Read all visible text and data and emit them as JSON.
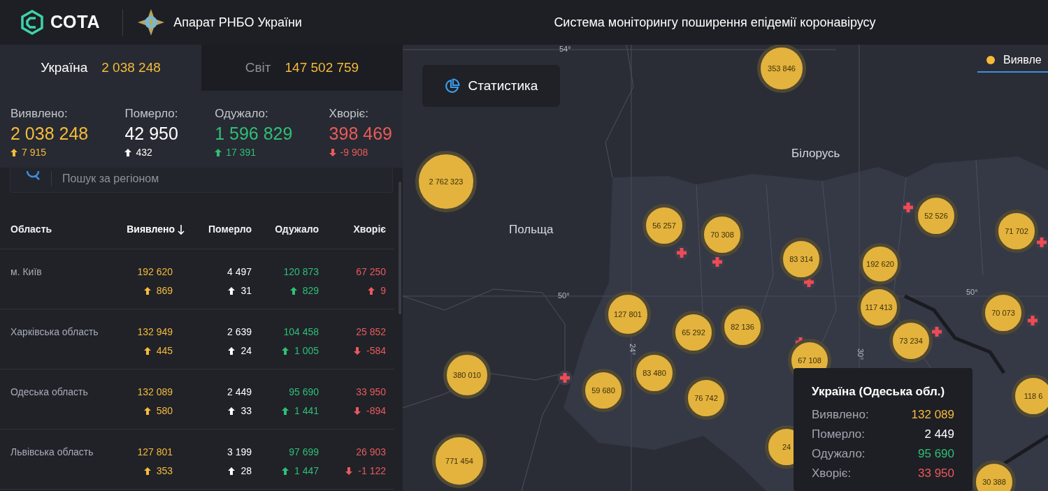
{
  "header": {
    "logo": "СОТА",
    "organization": "Апарат РНБО України",
    "title": "Система моніторингу поширення епідемії коронавірусу"
  },
  "scope_tabs": [
    {
      "label": "Україна",
      "total": "2 038 248",
      "selected": true
    },
    {
      "label": "Світ",
      "total": "147 502 759",
      "selected": false
    }
  ],
  "summary": [
    {
      "label": "Виявлено:",
      "value": "2 038 248",
      "change": "7 915",
      "rising": true,
      "color": "#f6bb3a"
    },
    {
      "label": "Померло:",
      "value": "42 950",
      "change": "432",
      "rising": true,
      "color": "#ffffff"
    },
    {
      "label": "Одужало:",
      "value": "1 596 829",
      "change": "17 391",
      "rising": true,
      "color": "#2fbf76"
    },
    {
      "label": "Хворіє:",
      "value": "398 469",
      "change": "-9 908",
      "rising": false,
      "color": "#ea5a5a"
    }
  ],
  "search": {
    "placeholder": "Пошук за регіоном"
  },
  "table": {
    "columns": [
      {
        "label": "Область",
        "sorted": false
      },
      {
        "label": "Виявлено",
        "sorted": true,
        "color": "#f6bb3a"
      },
      {
        "label": "Померло",
        "sorted": false,
        "color": "#ffffff"
      },
      {
        "label": "Одужало",
        "sorted": false,
        "color": "#2fbf76"
      },
      {
        "label": "Хворіє",
        "sorted": false,
        "color": "#ea5a5a"
      }
    ],
    "rows": [
      {
        "cells": [
          {
            "value": "м. Київ"
          },
          {
            "value": "192 620",
            "change": "869",
            "rising": true
          },
          {
            "value": "4 497",
            "change": "31",
            "rising": true
          },
          {
            "value": "120 873",
            "change": "829",
            "rising": true
          },
          {
            "value": "67 250",
            "change": "9",
            "rising": true
          }
        ]
      },
      {
        "cells": [
          {
            "value": "Харківська область"
          },
          {
            "value": "132 949",
            "change": "445",
            "rising": true
          },
          {
            "value": "2 639",
            "change": "24",
            "rising": true
          },
          {
            "value": "104 458",
            "change": "1 005",
            "rising": true
          },
          {
            "value": "25 852",
            "change": "-584",
            "rising": false
          }
        ]
      },
      {
        "cells": [
          {
            "value": "Одеська область"
          },
          {
            "value": "132 089",
            "change": "580",
            "rising": true
          },
          {
            "value": "2 449",
            "change": "33",
            "rising": true
          },
          {
            "value": "95 690",
            "change": "1 441",
            "rising": true
          },
          {
            "value": "33 950",
            "change": "-894",
            "rising": false
          }
        ]
      },
      {
        "cells": [
          {
            "value": "Львівська область"
          },
          {
            "value": "127 801",
            "change": "353",
            "rising": true
          },
          {
            "value": "3 199",
            "change": "28",
            "rising": true
          },
          {
            "value": "97 699",
            "change": "1 447",
            "rising": true
          },
          {
            "value": "26 903",
            "change": "-1 122",
            "rising": false
          }
        ]
      }
    ]
  },
  "map": {
    "stats_button": "Статистика",
    "legend": {
      "label": "Виявле",
      "selected": true,
      "color": "#f6bb3a"
    },
    "country_labels": [
      "Польща",
      "Білорусь"
    ],
    "grid_labels": [
      "54°",
      "50°",
      "24°",
      "30°",
      "50°"
    ],
    "clusters": [
      {
        "value": "353 846"
      },
      {
        "value": "2 762 323"
      },
      {
        "value": "56 257"
      },
      {
        "value": "70 308"
      },
      {
        "value": "83 314"
      },
      {
        "value": "52 526"
      },
      {
        "value": "71 702"
      },
      {
        "value": "192 620"
      },
      {
        "value": "117 413"
      },
      {
        "value": "127 801"
      },
      {
        "value": "65 292"
      },
      {
        "value": "82 136"
      },
      {
        "value": "70 073"
      },
      {
        "value": "73 234"
      },
      {
        "value": "67 108"
      },
      {
        "value": "380 010"
      },
      {
        "value": "59 680"
      },
      {
        "value": "83 480"
      },
      {
        "value": "76 742"
      },
      {
        "value": "771 454"
      },
      {
        "value": "24"
      },
      {
        "value": "118 6"
      },
      {
        "value": "30 388"
      }
    ],
    "tooltip": {
      "title": "Україна (Одеська обл.)",
      "rows": [
        {
          "label": "Виявлено:",
          "value": "132 089",
          "color": "#f6bb3a"
        },
        {
          "label": "Померло:",
          "value": "2 449",
          "color": "#ffffff"
        },
        {
          "label": "Одужало:",
          "value": "95 690",
          "color": "#2fbf76"
        },
        {
          "label": "Хворіє:",
          "value": "33 950",
          "color": "#ea5a5a"
        }
      ]
    }
  }
}
